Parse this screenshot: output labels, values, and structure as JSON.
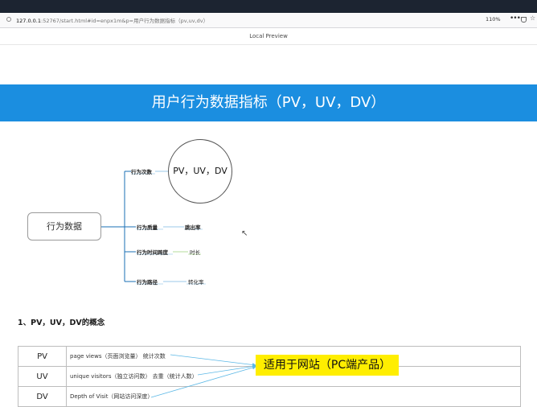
{
  "browser": {
    "url_host": "127.0.0.1",
    "url_rest": ":52767/start.html#id=enpx1m&p=用户行为数据指标（pv,uv,dv）",
    "zoom": "110%",
    "more": "•••"
  },
  "preview_title": "Local Preview",
  "banner_title": "用户行为数据指标（PV，UV，DV）",
  "mindmap": {
    "root": "行为数据",
    "branches": [
      {
        "label": "行为次数",
        "leaf": "PV，UV，DV"
      },
      {
        "label": "行为质量",
        "leaf": "跳出率"
      },
      {
        "label": "行为时间跨度",
        "leaf": "时长"
      },
      {
        "label": "行为路径",
        "leaf": "转化率"
      }
    ]
  },
  "section_heading": "1、PV，UV，DV的概念",
  "table": {
    "rows": [
      {
        "abbr": "PV",
        "desc": "page views（页面浏览量） 统计次数"
      },
      {
        "abbr": "UV",
        "desc": "unique visitors（独立访问数） 去重（统计人数）"
      },
      {
        "abbr": "DV",
        "desc": "Depth of Visit（网站访问深度）"
      }
    ]
  },
  "callout": "适用于网站（PC端产品）",
  "colors": {
    "banner": "#1b8ee0",
    "callout": "#ffee00",
    "arrow": "#5cb8e6"
  }
}
